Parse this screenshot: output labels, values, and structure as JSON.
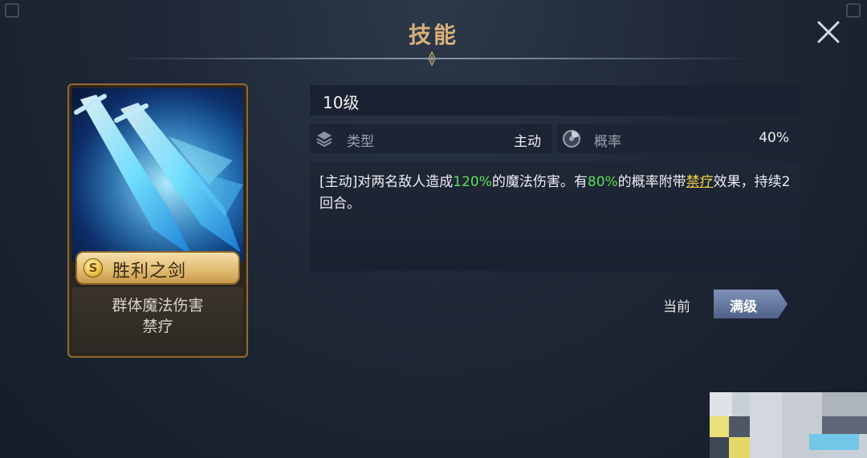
{
  "header": {
    "title": "技能"
  },
  "card": {
    "rarity": "S",
    "name": "胜利之剑",
    "tags": [
      "群体魔法伤害",
      "禁疗"
    ]
  },
  "skill": {
    "level": "10级",
    "type_label": "类型",
    "type_value": "主动",
    "rate_label": "概率",
    "rate_value": "40%",
    "description": {
      "p1": "[主动]对两名敌人造成",
      "v1": "120%",
      "p2": "的魔法伤害。有",
      "v2": "80%",
      "p3": "的概率附带",
      "kw": "禁疗",
      "p4": "效果，持续2回合。"
    }
  },
  "controls": {
    "current_label": "当前",
    "max_label": "满级"
  },
  "colors": {
    "title": "#d7b07a",
    "highlight_green": "#58e15a",
    "keyword_yellow": "#f0d24a",
    "card_border": "#8f6a34"
  },
  "icons": [
    "close-icon",
    "layers-icon",
    "dial-icon",
    "rarity-s-badge"
  ]
}
